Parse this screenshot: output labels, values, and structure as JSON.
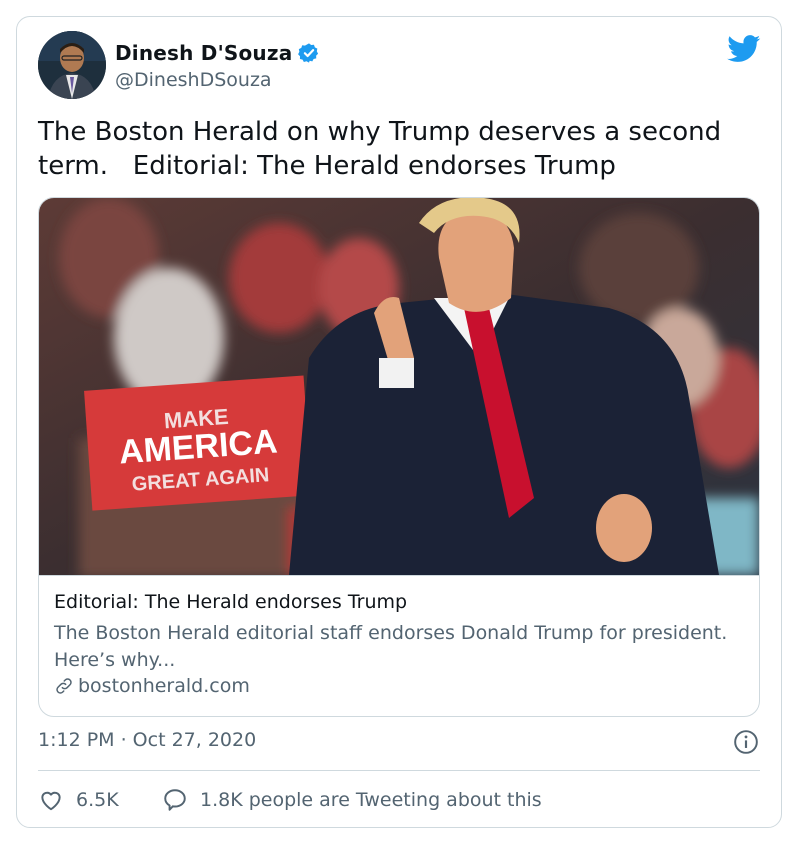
{
  "author": {
    "display_name": "Dinesh D'Souza",
    "handle": "@DineshDSouza",
    "verified": true
  },
  "tweet": {
    "text": "The Boston Herald on why Trump deserves a second\nterm.   Editorial: The Herald endorses Trump",
    "timestamp": "1:12 PM · Oct 27, 2020"
  },
  "link_card": {
    "title": "Editorial: The Herald endorses Trump",
    "description": "The Boston Herald editorial staff endorses Donald Trump for president. Here’s why...",
    "domain": "bostonherald.com",
    "image_sign_text": [
      "MAKE",
      "AMERICA",
      "GREAT AGAIN"
    ]
  },
  "stats": {
    "likes": "6.5K",
    "tweeting": "1.8K people are Tweeting about this"
  },
  "icons": {
    "brand": "twitter-bird-icon",
    "verified": "verified-badge-icon",
    "info": "info-icon",
    "like": "heart-icon",
    "reply": "speech-bubble-icon",
    "link": "link-icon"
  },
  "colors": {
    "brand_blue": "#1d9bf0",
    "text_primary": "#0f1419",
    "text_secondary": "#536471",
    "border": "#cfd9de"
  }
}
